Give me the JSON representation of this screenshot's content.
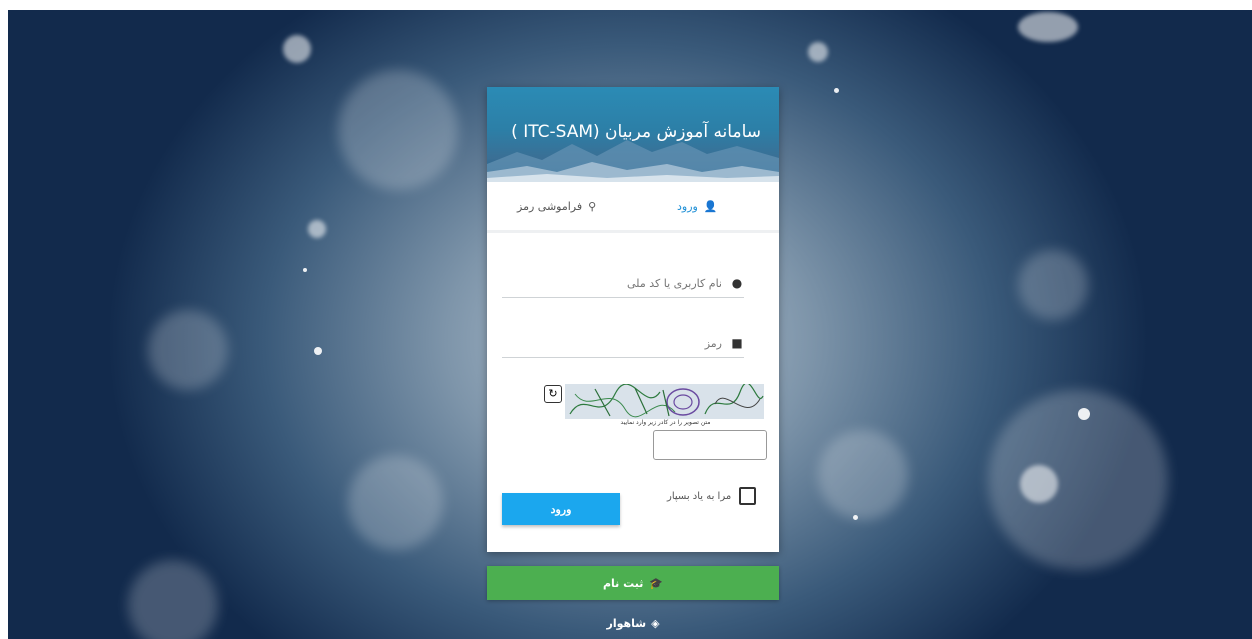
{
  "header": {
    "title": "سامانه آموزش مربیان (ITC-SAM )"
  },
  "tabs": [
    {
      "label": "ورود",
      "icon": "user-icon",
      "active": true
    },
    {
      "label": "فراموشی رمز",
      "icon": "key-icon",
      "active": false
    }
  ],
  "form": {
    "username_placeholder": "نام کاربری یا کد ملی",
    "password_placeholder": "رمز",
    "captcha_note": "متن تصویر را در کادر زیر وارد نمایید",
    "remember_label": "مرا به یاد بسپار",
    "login_button": "ورود"
  },
  "register_label": "ثبت نام",
  "footer_link": "شاهوار",
  "colors": {
    "accent_blue": "#1ba7ee",
    "register_green": "#4caf50",
    "tab_active": "#1e8fd6"
  }
}
